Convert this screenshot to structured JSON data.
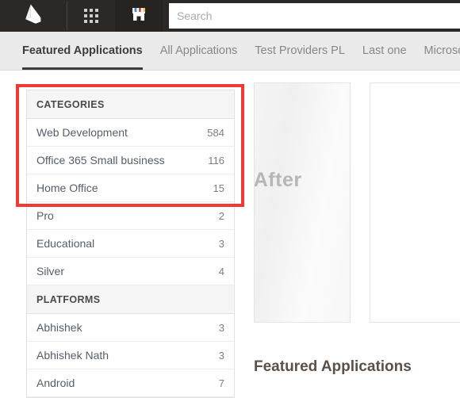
{
  "topbar": {
    "background": "#2b2826",
    "logo_icon": "dynamics-365-logo-icon",
    "waffle_icon": "app-launcher-grid-icon",
    "store_icon": "appsource-storefront-icon",
    "search": {
      "placeholder": "Search",
      "value": ""
    }
  },
  "tabs": [
    {
      "label": "Featured Applications",
      "active": true
    },
    {
      "label": "All Applications",
      "active": false
    },
    {
      "label": "Test Providers PL",
      "active": false
    },
    {
      "label": "Last one",
      "active": false
    },
    {
      "label": "Microsoft",
      "active": false
    }
  ],
  "sidebar": {
    "facets": [
      {
        "header": "CATEGORIES",
        "items": [
          {
            "label": "Web Development",
            "count": "584"
          },
          {
            "label": "Office 365 Small business",
            "count": "116"
          },
          {
            "label": "Home Office",
            "count": "15"
          },
          {
            "label": "Pro",
            "count": "2"
          },
          {
            "label": "Educational",
            "count": "3"
          },
          {
            "label": "Silver",
            "count": "4"
          }
        ]
      },
      {
        "header": "PLATFORMS",
        "items": [
          {
            "label": "Abhishek",
            "count": "3"
          },
          {
            "label": "Abhishek Nath",
            "count": "3"
          },
          {
            "label": "Android",
            "count": "7"
          }
        ]
      }
    ]
  },
  "main": {
    "cards": [
      {
        "ghost_text": "r After"
      },
      {
        "ghost_text": ""
      }
    ],
    "section_title": "Featured Applications"
  },
  "annotation": {
    "color": "#ef3b33",
    "target": "categories-facet"
  }
}
